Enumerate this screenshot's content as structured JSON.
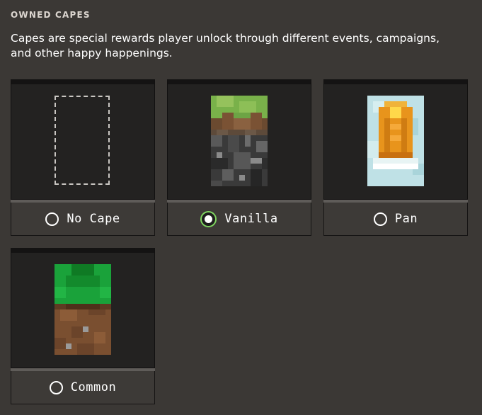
{
  "section": {
    "heading": "OWNED CAPES",
    "description": "Capes are special rewards player unlock through different events, campaigns, and other happy happenings."
  },
  "capes": [
    {
      "label": "No Cape",
      "selected": false,
      "icon": "empty-slot-icon"
    },
    {
      "label": "Vanilla",
      "selected": true,
      "icon": "vanilla-cape-icon"
    },
    {
      "label": "Pan",
      "selected": false,
      "icon": "pan-cape-icon"
    },
    {
      "label": "Common",
      "selected": false,
      "icon": "common-cape-icon"
    }
  ],
  "colors": {
    "background": "#3b3835",
    "card_preview": "#232221",
    "selected_radio_ring": "#7fd460"
  }
}
